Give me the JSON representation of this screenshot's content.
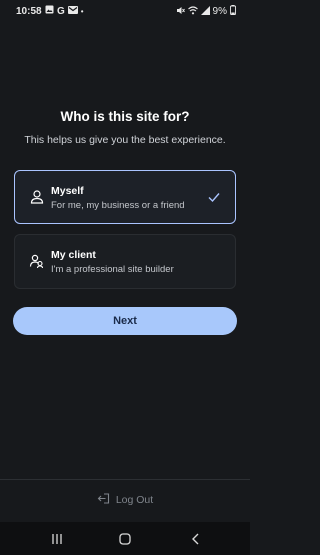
{
  "status_bar": {
    "time": "10:58",
    "battery": "9%",
    "left_icons": [
      "image-icon",
      "g-icon",
      "gmail-icon",
      "dot-icon"
    ],
    "right_icons": [
      "mute-icon",
      "wifi-icon",
      "signal-icon",
      "battery-icon"
    ]
  },
  "header": {
    "title": "Who is this site for?",
    "subtitle": "This helps us give you the best experience."
  },
  "options": [
    {
      "title": "Myself",
      "description": "For me, my business or a friend",
      "icon": "person-icon",
      "selected": true
    },
    {
      "title": "My client",
      "description": "I'm a professional site builder",
      "icon": "people-icon",
      "selected": false
    }
  ],
  "next_label": "Next",
  "logout_label": "Log Out",
  "colors": {
    "background": "#17191c",
    "accent": "#a8c8fb",
    "selected_border": "#aac4ff"
  },
  "nav": [
    "recents-icon",
    "home-icon",
    "back-icon"
  ]
}
